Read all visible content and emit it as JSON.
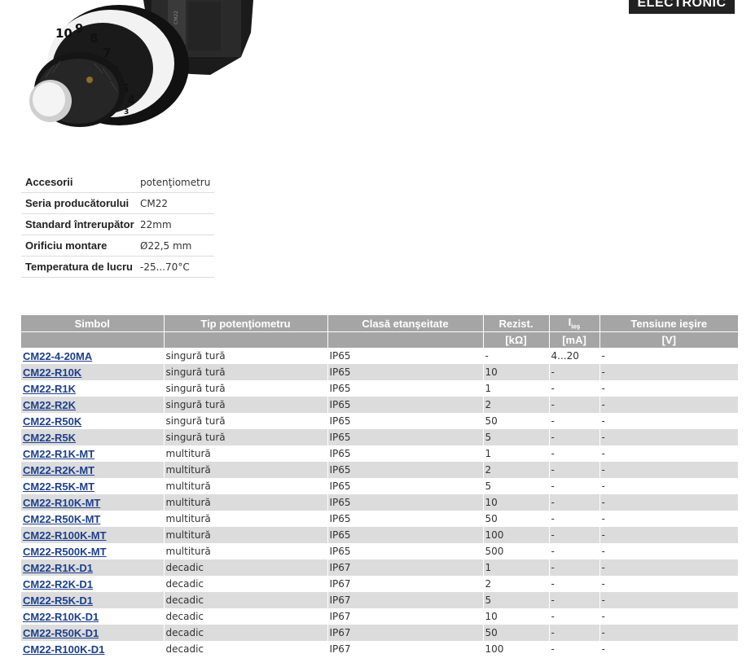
{
  "brand": {
    "logo_text": "ELECTRONIC"
  },
  "product_image": {
    "dial_numbers": [
      "10",
      "9",
      "8",
      "7",
      "6",
      "5",
      "4",
      "3"
    ]
  },
  "specs": [
    {
      "key": "Accesorii",
      "value": "potenţiometru"
    },
    {
      "key": "Seria producătorului",
      "value": "CM22"
    },
    {
      "key": "Standard întrerupător",
      "value": "22mm"
    },
    {
      "key": "Orificiu montare",
      "value": "Ø22,5 mm"
    },
    {
      "key": "Temperatura de lucru",
      "value": "-25...70°C"
    }
  ],
  "table": {
    "headers": {
      "simbol": "Simbol",
      "tip": "Tip potenţiometru",
      "clasa": "Clasă etanşeitate",
      "rezist": "Rezist.",
      "ies_main": "I",
      "ies_sub": "ieş",
      "tensiune": "Tensiune ieşire"
    },
    "units": {
      "rezist": "[kΩ]",
      "ies": "[mA]",
      "tensiune": "[V]"
    },
    "rows": [
      {
        "simbol": "CM22-4-20MA",
        "tip": "singură tură",
        "clasa": "IP65",
        "rezist": "-",
        "ies": "4...20",
        "tensiune": "-"
      },
      {
        "simbol": "CM22-R10K",
        "tip": "singură tură",
        "clasa": "IP65",
        "rezist": "10",
        "ies": "-",
        "tensiune": "-"
      },
      {
        "simbol": "CM22-R1K",
        "tip": "singură tură",
        "clasa": "IP65",
        "rezist": "1",
        "ies": "-",
        "tensiune": "-"
      },
      {
        "simbol": "CM22-R2K",
        "tip": "singură tură",
        "clasa": "IP65",
        "rezist": "2",
        "ies": "-",
        "tensiune": "-"
      },
      {
        "simbol": "CM22-R50K",
        "tip": "singură tură",
        "clasa": "IP65",
        "rezist": "50",
        "ies": "-",
        "tensiune": "-"
      },
      {
        "simbol": "CM22-R5K",
        "tip": "singură tură",
        "clasa": "IP65",
        "rezist": "5",
        "ies": "-",
        "tensiune": "-"
      },
      {
        "simbol": "CM22-R1K-MT",
        "tip": "multitură",
        "clasa": "IP65",
        "rezist": "1",
        "ies": "-",
        "tensiune": "-"
      },
      {
        "simbol": "CM22-R2K-MT",
        "tip": "multitură",
        "clasa": "IP65",
        "rezist": "2",
        "ies": "-",
        "tensiune": "-"
      },
      {
        "simbol": "CM22-R5K-MT",
        "tip": "multitură",
        "clasa": "IP65",
        "rezist": "5",
        "ies": "-",
        "tensiune": "-"
      },
      {
        "simbol": "CM22-R10K-MT",
        "tip": "multitură",
        "clasa": "IP65",
        "rezist": "10",
        "ies": "-",
        "tensiune": "-"
      },
      {
        "simbol": "CM22-R50K-MT",
        "tip": "multitură",
        "clasa": "IP65",
        "rezist": "50",
        "ies": "-",
        "tensiune": "-"
      },
      {
        "simbol": "CM22-R100K-MT",
        "tip": "multitură",
        "clasa": "IP65",
        "rezist": "100",
        "ies": "-",
        "tensiune": "-"
      },
      {
        "simbol": "CM22-R500K-MT",
        "tip": "multitură",
        "clasa": "IP65",
        "rezist": "500",
        "ies": "-",
        "tensiune": "-"
      },
      {
        "simbol": "CM22-R1K-D1",
        "tip": "decadic",
        "clasa": "IP67",
        "rezist": "1",
        "ies": "-",
        "tensiune": "-"
      },
      {
        "simbol": "CM22-R2K-D1",
        "tip": "decadic",
        "clasa": "IP67",
        "rezist": "2",
        "ies": "-",
        "tensiune": "-"
      },
      {
        "simbol": "CM22-R5K-D1",
        "tip": "decadic",
        "clasa": "IP67",
        "rezist": "5",
        "ies": "-",
        "tensiune": "-"
      },
      {
        "simbol": "CM22-R10K-D1",
        "tip": "decadic",
        "clasa": "IP67",
        "rezist": "10",
        "ies": "-",
        "tensiune": "-"
      },
      {
        "simbol": "CM22-R50K-D1",
        "tip": "decadic",
        "clasa": "IP67",
        "rezist": "50",
        "ies": "-",
        "tensiune": "-"
      },
      {
        "simbol": "CM22-R100K-D1",
        "tip": "decadic",
        "clasa": "IP67",
        "rezist": "100",
        "ies": "-",
        "tensiune": "-"
      }
    ]
  },
  "colors": {
    "header_bg": "#a5a5a5",
    "row_alt_bg": "#dcdcdc",
    "link": "#1d3f8a"
  }
}
